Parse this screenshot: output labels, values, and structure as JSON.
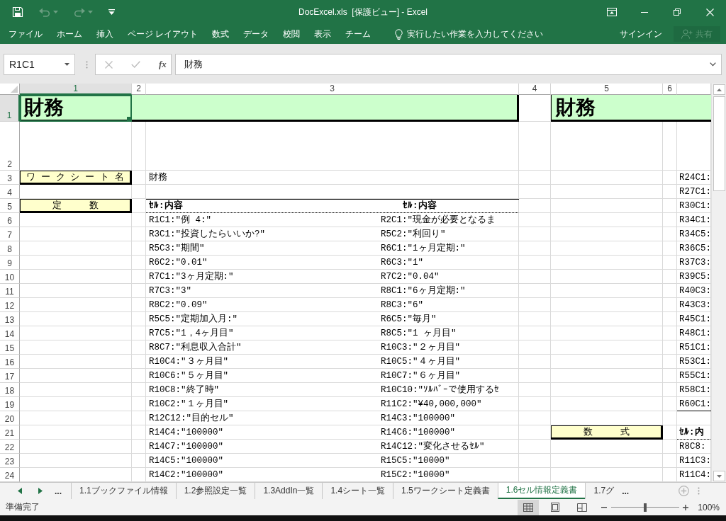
{
  "window": {
    "title": "DocExcel.xls  [保護ビュー] - Excel"
  },
  "quick_access": [
    {
      "kind": "save",
      "disabled": false
    },
    {
      "kind": "undo",
      "disabled": true
    },
    {
      "kind": "redo",
      "disabled": true
    },
    {
      "kind": "customize",
      "disabled": false
    }
  ],
  "ribbon": {
    "tabs": [
      {
        "label": "ファイル",
        "selected": false
      },
      {
        "label": "ホーム",
        "selected": false
      },
      {
        "label": "挿入",
        "selected": false
      },
      {
        "label": "ページ レイアウト",
        "selected": false
      },
      {
        "label": "数式",
        "selected": false
      },
      {
        "label": "データ",
        "selected": false
      },
      {
        "label": "校閲",
        "selected": false
      },
      {
        "label": "表示",
        "selected": false
      },
      {
        "label": "チーム",
        "selected": false
      }
    ],
    "tell_me": "実行したい作業を入力してください",
    "sign_in": "サインイン",
    "share": {
      "label": "共有",
      "disabled": true
    }
  },
  "formula_bar": {
    "name_box": "R1C1",
    "function_label": "fx",
    "value": "財務"
  },
  "sheet": {
    "columns": [
      {
        "label": "1",
        "selected": true
      },
      {
        "label": "2",
        "selected": false
      },
      {
        "label": "3",
        "selected": false
      },
      {
        "label": "4",
        "selected": false
      },
      {
        "label": "5",
        "selected": false
      },
      {
        "label": "6",
        "selected": false
      }
    ],
    "rows": [
      {
        "label": "1",
        "selected": true
      },
      {
        "label": "2",
        "selected": false
      },
      {
        "label": "3",
        "selected": false
      },
      {
        "label": "4",
        "selected": false
      },
      {
        "label": "5",
        "selected": false
      },
      {
        "label": "6",
        "selected": false
      },
      {
        "label": "7",
        "selected": false
      },
      {
        "label": "8",
        "selected": false
      },
      {
        "label": "9",
        "selected": false
      },
      {
        "label": "10",
        "selected": false
      },
      {
        "label": "11",
        "selected": false
      },
      {
        "label": "12",
        "selected": false
      },
      {
        "label": "13",
        "selected": false
      },
      {
        "label": "14",
        "selected": false
      },
      {
        "label": "15",
        "selected": false
      },
      {
        "label": "16",
        "selected": false
      },
      {
        "label": "17",
        "selected": false
      },
      {
        "label": "18",
        "selected": false
      },
      {
        "label": "19",
        "selected": false
      },
      {
        "label": "20",
        "selected": false
      },
      {
        "label": "21",
        "selected": false
      },
      {
        "label": "22",
        "selected": false
      },
      {
        "label": "23",
        "selected": false
      },
      {
        "label": "24",
        "selected": false
      }
    ],
    "banners": [
      "財務",
      "財務"
    ],
    "labels": [
      "ワ ー ク シ ー ト 名",
      "定　　　数",
      "数　　　式"
    ],
    "sheet_name": "財務",
    "cell_list": {
      "headers": [
        "ｾﾙ:内容",
        "ｾﾙ:内容"
      ],
      "left": [
        "R1C1:\"例 4:\"",
        "R3C1:\"投資したらいいか?\"",
        "R5C3:\"期間\"",
        "R6C2:\"0.01\"",
        "R7C1:\"3ヶ月定期:\"",
        "R7C3:\"3\"",
        "R8C2:\"0.09\"",
        "R5C5:\"定期加入月:\"",
        "R7C5:\"1，4ヶ月目\"",
        "R8C7:\"利息収入合計\"",
        "R10C4:\"３ヶ月目\"",
        "R10C6:\"５ヶ月目\"",
        "R10C8:\"終了時\"",
        "R10C2:\"１ヶ月目\"",
        "R12C12:\"目的セル\"",
        "R14C4:\"100000\"",
        "R14C7:\"100000\"",
        "R14C5:\"100000\"",
        "R14C2:\"100000\""
      ],
      "right": [
        "R2C1:\"現金が必要となるま",
        "R5C2:\"利回り\"",
        "R6C1:\"1ヶ月定期:\"",
        "R6C3:\"1\"",
        "R7C2:\"0.04\"",
        "R8C1:\"6ヶ月定期:\"",
        "R8C3:\"6\"",
        "R6C5:\"毎月\"",
        "R8C5:\"1 ヶ月目\"",
        "R10C3:\"２ヶ月目\"",
        "R10C5:\"４ヶ月目\"",
        "R10C7:\"６ヶ月目\"",
        "R10C10:\"ｿﾙﾊﾞｰで使用するｾ",
        "R11C2:\"¥40,000,000\"",
        "R14C3:\"100000\"",
        "R14C6:\"100000\"",
        "R14C12:\"変化させるｾﾙ\"",
        "R15C5:\"10000\"",
        "R15C2:\"10000\""
      ]
    },
    "side_list": {
      "items": [
        "R24C1:",
        "R27C1:",
        "R30C1:",
        "R34C1:",
        "R34C5:",
        "R36C5:",
        "R37C3:",
        "R39C5:",
        "R40C3:",
        "R43C3:",
        "R45C1:",
        "R48C1:",
        "R51C1:",
        "R53C1:",
        "R55C1:",
        "R58C1:",
        "R60C1:"
      ],
      "header": "ｾﾙ:内",
      "items_below": [
        "R8C8:",
        "R11C3:",
        "R11C4:"
      ]
    }
  },
  "sheet_tabs": {
    "nav_more": "...",
    "tabs": [
      {
        "label": "1.1ブックファイル情報",
        "selected": false
      },
      {
        "label": "1.2参照設定一覧",
        "selected": false
      },
      {
        "label": "1.3AddIn一覧",
        "selected": false
      },
      {
        "label": "1.4シート一覧",
        "selected": false
      },
      {
        "label": "1.5ワークシート定義書",
        "selected": false
      },
      {
        "label": "1.6セル情報定義書",
        "selected": true
      },
      {
        "label": "1.7グ",
        "selected": false
      }
    ],
    "overflow": "..."
  },
  "status_bar": {
    "text": "準備完了",
    "views": [
      {
        "kind": "normal",
        "selected": true
      },
      {
        "kind": "page_layout",
        "selected": false
      },
      {
        "kind": "page_break",
        "selected": false
      }
    ],
    "zoom": {
      "level": 0.5,
      "reading": "100%"
    }
  }
}
